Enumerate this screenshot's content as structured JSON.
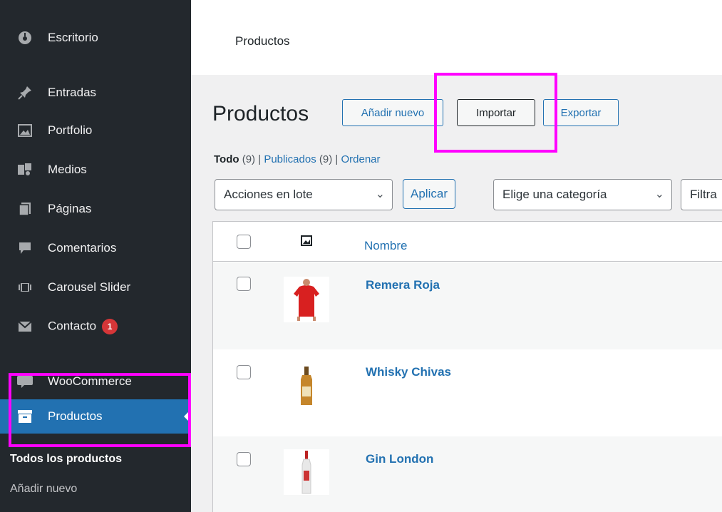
{
  "sidebar": {
    "items": [
      {
        "label": "Escritorio",
        "icon": "dashboard-icon"
      },
      {
        "label": "Entradas",
        "icon": "pushpin-icon"
      },
      {
        "label": "Portfolio",
        "icon": "image-icon"
      },
      {
        "label": "Medios",
        "icon": "media-icon"
      },
      {
        "label": "Páginas",
        "icon": "pages-icon"
      },
      {
        "label": "Comentarios",
        "icon": "comment-icon"
      },
      {
        "label": "Carousel Slider",
        "icon": "slider-icon"
      },
      {
        "label": "Contacto",
        "icon": "envelope-icon",
        "badge": "1"
      },
      {
        "label": "WooCommerce",
        "icon": "woo-icon"
      },
      {
        "label": "Productos",
        "icon": "archive-icon"
      }
    ],
    "submenu": [
      "Todos los productos",
      "Añadir nuevo"
    ]
  },
  "topbar": {
    "title": "Productos"
  },
  "page": {
    "heading": "Productos",
    "buttons": {
      "add": "Añadir nuevo",
      "import": "Importar",
      "export": "Exportar"
    },
    "filters": {
      "all_label": "Todo",
      "all_count": "(9)",
      "sep1": "|",
      "published_label": "Publicados",
      "published_count": "(9)",
      "sep2": "|",
      "sort_label": "Ordenar"
    },
    "bulk_select": "Acciones en lote",
    "apply_button": "Aplicar",
    "category_select": "Elige una categoría",
    "filter_partial": "Filtra"
  },
  "table": {
    "columns": {
      "name": "Nombre"
    },
    "rows": [
      {
        "name": "Remera Roja"
      },
      {
        "name": "Whisky Chivas"
      },
      {
        "name": "Gin London"
      }
    ]
  },
  "colors": {
    "accent": "#2271b1",
    "sidebar": "#23282d",
    "highlight": "#ff00ff",
    "badge": "#d63638"
  }
}
